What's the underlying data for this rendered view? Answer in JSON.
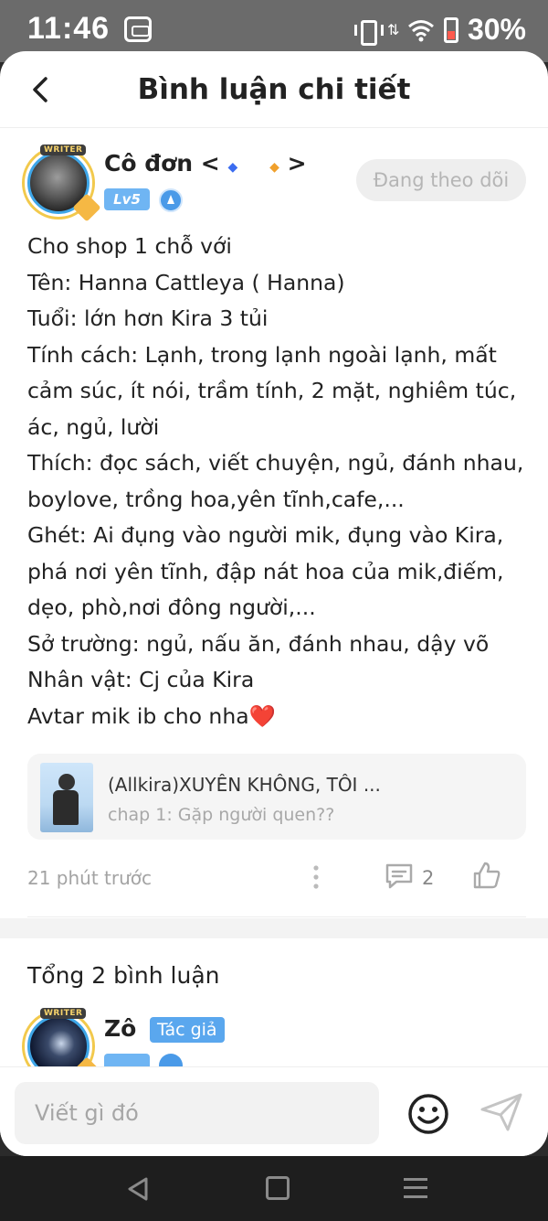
{
  "status_bar": {
    "time": "11:46",
    "battery_percent": "30%"
  },
  "header": {
    "title": "Bình luận chi tiết",
    "back_icon": "chevron-left-icon"
  },
  "comment": {
    "username_main": "Cô đơn <",
    "username_diamond_1": "◆",
    "username_diamond_2": "◆",
    "username_end": ">",
    "avatar_tag": "WRITER",
    "level": "Lv5",
    "follow_label": "Đang theo dõi",
    "lines": [
      "Cho shop 1 chỗ với",
      "Tên: Hanna Cattleya ( Hanna)",
      "Tuổi: lớn hơn Kira 3 tủi",
      "Tính cách: Lạnh, trong lạnh ngoài lạnh, mất",
      "cảm súc, ít nói, trầm tính, 2 mặt, nghiêm túc,",
      "ác, ngủ, lười",
      "Thích: đọc sách, viết chuyện, ngủ, đánh nhau,",
      "boylove, trồng hoa,yên tĩnh,cafe,...",
      "Ghét: Ai đụng vào người mik, đụng vào Kira,",
      "phá nơi yên tĩnh, đập nát hoa của mik,điếm,",
      "dẹo, phò,nơi đông người,...",
      "Sở trường: ngủ, nấu ăn, đánh nhau, dậy võ",
      "Nhân vật: Cj của Kira",
      "Avtar mik ib cho nha"
    ],
    "heart": "❤️",
    "story": {
      "title": "(Allkira)XUYÊN KHÔNG, TÔI ...",
      "chapter": "chap 1: Gặp người quen??"
    },
    "time_ago": "21 phút trước",
    "reply_count": "2"
  },
  "replies_section": {
    "total_label": "Tổng 2 bình luận",
    "first_reply": {
      "username": "Zô",
      "avatar_tag": "WRITER",
      "author_badge": "Tác giả"
    }
  },
  "input_bar": {
    "placeholder": "Viết gì đó"
  },
  "colors": {
    "accent": "#5aa7ee",
    "heart": "#e03232",
    "follow_text": "#b5b5b5"
  }
}
